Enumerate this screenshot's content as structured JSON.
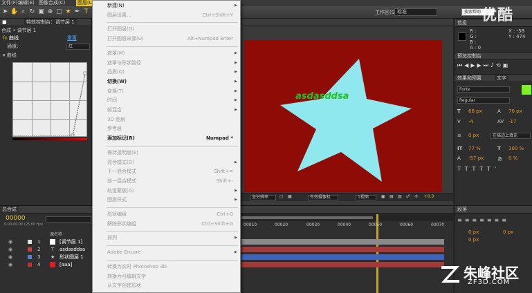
{
  "menubar": {
    "items": [
      "文件(F)",
      "编辑(E)",
      "图像合成(C)",
      "图层(L)"
    ]
  },
  "toolbar": {
    "workspace_label": "工作区(S):",
    "workspace_value": "标准",
    "search_placeholder": "搜索帮助"
  },
  "effects_panel": {
    "tab_label": "合成 • 调节层 1",
    "tab2_label": "特效控制台：调节层 1",
    "layer_label": "合成 • 调节层 1",
    "effect_name": "曲线",
    "reset_label": "重置",
    "channel_label": "通道:",
    "channel_value": "红",
    "curve_label": "曲线"
  },
  "layer_menu": {
    "items": [
      {
        "label": "新建(N)",
        "shortcut": "",
        "arrow": true,
        "disabled": false,
        "bold": false
      },
      {
        "label": "图层设置...",
        "shortcut": "Ctrl+Shift+Y",
        "arrow": false,
        "disabled": true,
        "bold": false
      },
      {
        "sep": true
      },
      {
        "label": "打开图层(O)",
        "shortcut": "",
        "arrow": false,
        "disabled": true,
        "bold": false
      },
      {
        "label": "打开图层来源(U)",
        "shortcut": "Alt+Numpad Enter",
        "arrow": false,
        "disabled": true,
        "bold": false
      },
      {
        "sep": true
      },
      {
        "label": "遮罩(M)",
        "shortcut": "",
        "arrow": true,
        "disabled": true,
        "bold": false
      },
      {
        "label": "遮罩与形状路径",
        "shortcut": "",
        "arrow": true,
        "disabled": true,
        "bold": false
      },
      {
        "label": "品质(Q)",
        "shortcut": "",
        "arrow": true,
        "disabled": true,
        "bold": false
      },
      {
        "label": "切换(W)",
        "shortcut": "",
        "arrow": true,
        "disabled": false,
        "bold": true
      },
      {
        "label": "变换(T)",
        "shortcut": "",
        "arrow": true,
        "disabled": true,
        "bold": false
      },
      {
        "label": "时间",
        "shortcut": "",
        "arrow": true,
        "disabled": true,
        "bold": false
      },
      {
        "label": "帧混合",
        "shortcut": "",
        "arrow": true,
        "disabled": true,
        "bold": false
      },
      {
        "label": "3D 图层",
        "shortcut": "",
        "arrow": false,
        "disabled": true,
        "bold": false
      },
      {
        "label": "参考层",
        "shortcut": "",
        "arrow": false,
        "disabled": true,
        "bold": false
      },
      {
        "label": "添加标记(R)",
        "shortcut": "Numpad *",
        "arrow": false,
        "disabled": false,
        "bold": true
      },
      {
        "sep": true
      },
      {
        "label": "保持透明度(E)",
        "shortcut": "",
        "arrow": false,
        "disabled": true,
        "bold": false
      },
      {
        "label": "混合模式(D)",
        "shortcut": "",
        "arrow": true,
        "disabled": true,
        "bold": false
      },
      {
        "label": "下一混合模式",
        "shortcut": "Shift+=",
        "arrow": false,
        "disabled": true,
        "bold": false
      },
      {
        "label": "前一混合模式",
        "shortcut": "Shift+-",
        "arrow": false,
        "disabled": true,
        "bold": false
      },
      {
        "label": "轨道蒙板(A)",
        "shortcut": "",
        "arrow": true,
        "disabled": true,
        "bold": false
      },
      {
        "label": "图层样式",
        "shortcut": "",
        "arrow": true,
        "disabled": true,
        "bold": false
      },
      {
        "sep": true
      },
      {
        "label": "形状编组",
        "shortcut": "Ctrl+G",
        "arrow": false,
        "disabled": true,
        "bold": false
      },
      {
        "label": "解除形状编组",
        "shortcut": "Ctrl+Shift+G",
        "arrow": false,
        "disabled": true,
        "bold": false
      },
      {
        "sep": true
      },
      {
        "label": "排列",
        "shortcut": "",
        "arrow": true,
        "disabled": true,
        "bold": false
      },
      {
        "sep": true
      },
      {
        "label": "Adobe Encore",
        "shortcut": "",
        "arrow": true,
        "disabled": true,
        "bold": false
      },
      {
        "sep": true
      },
      {
        "label": "转换为实时 Photoshop 3D",
        "shortcut": "",
        "arrow": false,
        "disabled": true,
        "bold": false
      },
      {
        "label": "转换为可编辑文字",
        "shortcut": "",
        "arrow": false,
        "disabled": true,
        "bold": false
      },
      {
        "label": "从文字创建形状",
        "shortcut": "",
        "arrow": false,
        "disabled": true,
        "bold": false
      },
      {
        "label": "从文字创建轮廓线",
        "shortcut": "",
        "arrow": false,
        "disabled": true,
        "bold": false
      }
    ]
  },
  "composition": {
    "text": "asdasddsa",
    "background_color": "#8e0b06",
    "star_color": "#8ee8ee",
    "text_color": "#22c21e"
  },
  "viewer_bar": {
    "resolution": "全分辨率",
    "camera": "有效摄像机",
    "views": "1视图",
    "exposure": "+0.0"
  },
  "info_panel": {
    "tab": "信息",
    "r": "R :",
    "g": "G :",
    "b": "B :",
    "a": "A : 0",
    "x": "X : -58",
    "y": "Y : 474"
  },
  "preview_panel": {
    "tab": "预览控制台"
  },
  "char_panel": {
    "tab1": "效果和预置",
    "tab2": "文字",
    "font": "Forte",
    "style": "Regular",
    "size": "68 px",
    "leading": "70 px",
    "kerning": "-4",
    "tracking": "-17",
    "stroke_width": "0 px",
    "stroke_mode": "在描边上填充",
    "v_scale": "77 %",
    "h_scale": "100 %",
    "baseline": "-57 px",
    "tsume": "0 %"
  },
  "paragraph_panel": {
    "tab": "段落",
    "indent1": "0 px",
    "indent2": "0 px",
    "indent3": "0 px"
  },
  "timeline": {
    "tab": "总合成",
    "timecode": "00000",
    "fps": "0:00:00:00 (25.00 fps)",
    "col_source": "源名称",
    "ruler": [
      "00010",
      "00020",
      "00030",
      "00040",
      "00050",
      "00060",
      "00070"
    ],
    "layers": [
      {
        "num": "1",
        "name": "[调节层 1]",
        "color": "#e0e0e0"
      },
      {
        "num": "2",
        "name": "asdasddsa",
        "color": "#d04040"
      },
      {
        "num": "3",
        "name": "形状图层 1",
        "color": "#5a7fd0"
      },
      {
        "num": "4",
        "name": "[aaa]",
        "color": "#c03030"
      }
    ]
  },
  "watermarks": {
    "top": "优酷",
    "brand": "朱峰社区",
    "url": "ZF3D.COM"
  }
}
